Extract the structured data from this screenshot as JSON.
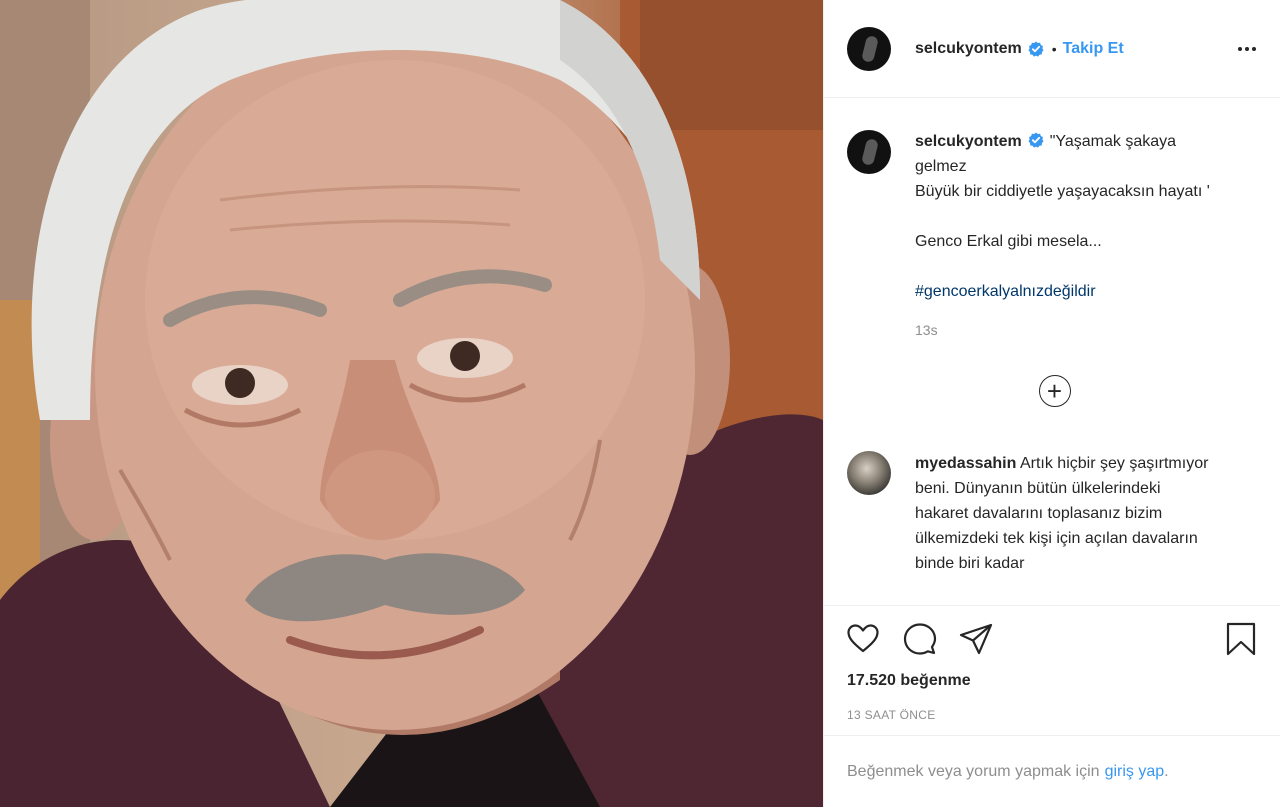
{
  "photo": {
    "alt_subject": "portrait-photo"
  },
  "header": {
    "username": "selcukyontem",
    "separator": "•",
    "follow_label": "Takip Et"
  },
  "caption": {
    "username": "selcukyontem",
    "lines": "\"Yaşamak şakaya gelmez\nBüyük bir ciddiyetle yaşayacaksın hayatı '\n\nGenco Erkal gibi mesela...\n\n",
    "hashtag": "#gencoerkalyalnızdeğildir",
    "time": "13s"
  },
  "comment": {
    "username": "myedassahin",
    "text": "Artık hiçbir şey şaşırtmıyor beni. Dünyanın bütün ülkelerindeki hakaret davalarını toplasanız bizim ülkemizdeki tek kişi için açılan davaların binde biri kadar"
  },
  "actions": {
    "likes": "17.520 beğenme",
    "time_ago": "13 SAAT ÖNCE"
  },
  "login_prompt": {
    "text": "Beğenmek veya yorum yapmak için",
    "link": "giriş yap",
    "suffix": "."
  },
  "icons": {
    "like": "heart-icon",
    "comment": "comment-icon",
    "share": "share-icon",
    "save": "bookmark-icon",
    "more": "more-icon",
    "load_more": "plus-circle-icon",
    "verified": "verified-badge-icon"
  },
  "colors": {
    "link": "#3897f0",
    "text": "#262626",
    "muted": "#8e8e8e"
  }
}
